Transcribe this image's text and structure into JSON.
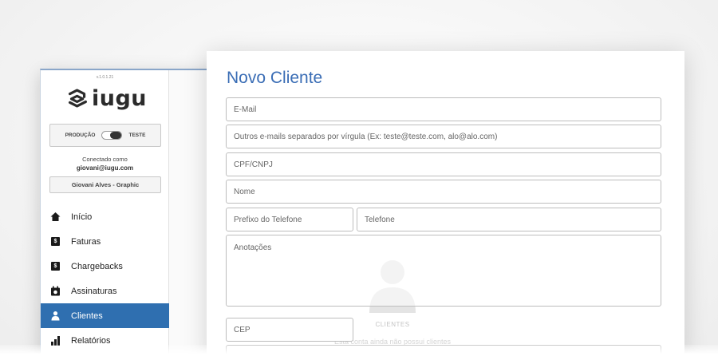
{
  "app": {
    "version": "v.1.0.1.21",
    "brand": "iugu"
  },
  "environment": {
    "production_label": "PRODUÇÃO",
    "test_label": "TESTE"
  },
  "session": {
    "connected_label": "Conectado como",
    "email": "giovani@iugu.com",
    "account_name": "Giovani Alves - Graphic"
  },
  "nav": {
    "items": [
      {
        "label": "Início",
        "icon": "home-icon"
      },
      {
        "label": "Faturas",
        "icon": "invoice-icon"
      },
      {
        "label": "Chargebacks",
        "icon": "chargeback-icon"
      },
      {
        "label": "Assinaturas",
        "icon": "subscription-icon"
      },
      {
        "label": "Clientes",
        "icon": "customers-icon",
        "active": true
      },
      {
        "label": "Relatórios",
        "icon": "reports-icon"
      }
    ]
  },
  "form": {
    "title": "Novo Cliente",
    "fields": {
      "email": {
        "placeholder": "E-Mail"
      },
      "other_emails": {
        "placeholder": "Outros e-mails separados por vírgula (Ex: teste@teste.com, alo@alo.com)"
      },
      "document": {
        "placeholder": "CPF/CNPJ"
      },
      "name": {
        "placeholder": "Nome"
      },
      "phone_prefix": {
        "placeholder": "Prefixo do Telefone"
      },
      "phone": {
        "placeholder": "Telefone"
      },
      "notes": {
        "placeholder": "Anotações"
      },
      "zip": {
        "placeholder": "CEP"
      }
    }
  },
  "empty_state": {
    "title": "CLIENTES",
    "subtitle": "Esta conta ainda não possui clientes"
  },
  "colors": {
    "accent": "#2f6fb0",
    "title": "#3a6db5"
  }
}
